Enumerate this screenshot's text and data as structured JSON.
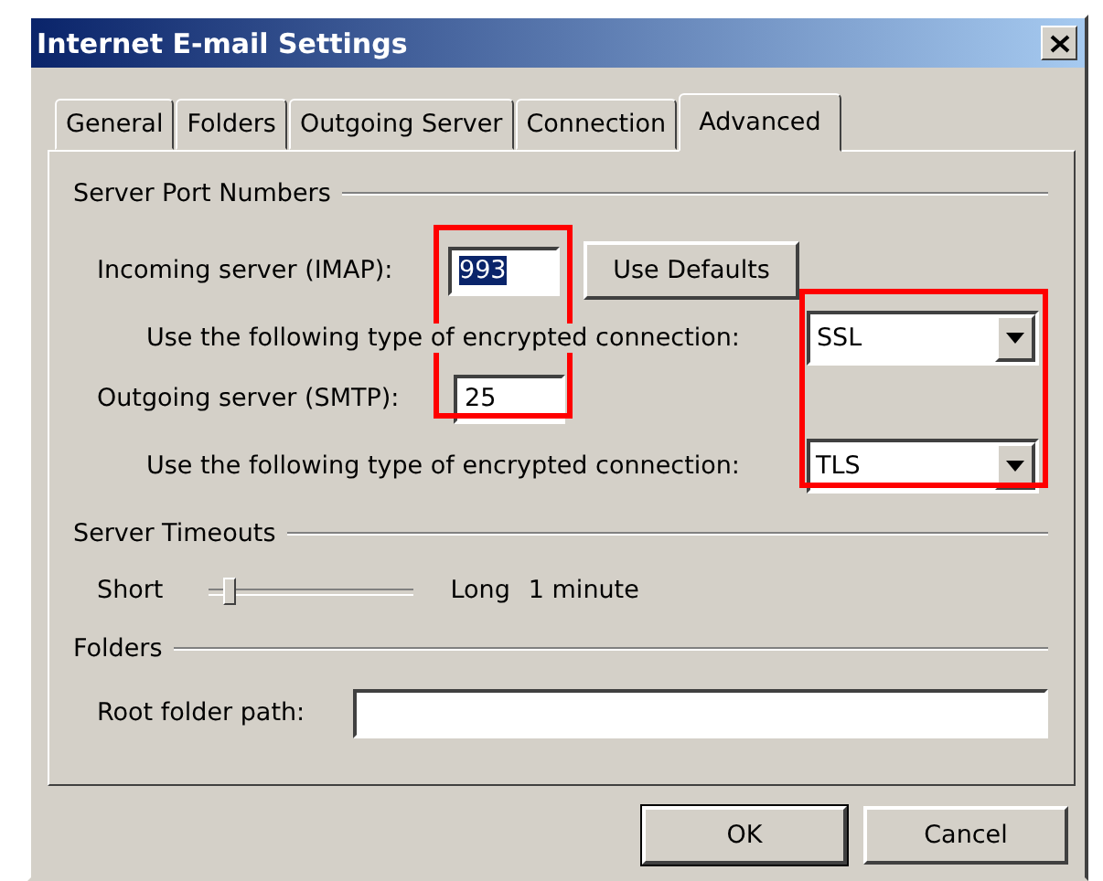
{
  "window": {
    "title": "Internet E-mail Settings"
  },
  "tabs": [
    {
      "label": "General",
      "selected": false
    },
    {
      "label": "Folders",
      "selected": false
    },
    {
      "label": "Outgoing Server",
      "selected": false
    },
    {
      "label": "Connection",
      "selected": false
    },
    {
      "label": "Advanced",
      "selected": true
    }
  ],
  "server_port_numbers": {
    "title": "Server Port Numbers",
    "incoming": {
      "label": "Incoming server (IMAP):",
      "value": "993",
      "text_selected": true
    },
    "use_defaults_button": "Use Defaults",
    "incoming_encryption": {
      "label": "Use the following type of encrypted connection:",
      "value": "SSL"
    },
    "outgoing": {
      "label": "Outgoing server (SMTP):",
      "value": "25",
      "text_selected": false
    },
    "outgoing_encryption": {
      "label": "Use the following type of encrypted connection:",
      "value": "TLS"
    }
  },
  "server_timeouts": {
    "title": "Server Timeouts",
    "min_label": "Short",
    "level": 0.1,
    "max_label": "Long",
    "reading": "1 minute"
  },
  "folders": {
    "title": "Folders",
    "root_folder": {
      "label": "Root folder path:"
    }
  },
  "buttons": [
    "OK",
    "Cancel"
  ]
}
